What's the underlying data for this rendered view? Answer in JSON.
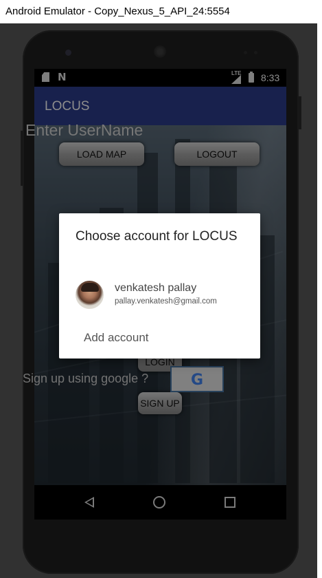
{
  "window": {
    "title": "Android Emulator - Copy_Nexus_5_API_24:5554"
  },
  "status_bar": {
    "network": "LTE",
    "time": "8:33",
    "icons": [
      "sd-card-icon",
      "n-icon",
      "signal-icon",
      "battery-icon"
    ]
  },
  "app_bar": {
    "title": "LOCUS",
    "color": "#2c3c8c"
  },
  "main": {
    "load_map_label": "LOAD MAP",
    "logout_label": "LOGOUT",
    "username_placeholder": "Enter UserName",
    "login_label": "LOGIN",
    "signup_label": "SIGN UP",
    "google_signup_text": "Sign up using google ?",
    "google_logo": "G"
  },
  "dialog": {
    "title": "Choose account for LOCUS",
    "account": {
      "name": "venkatesh pallay",
      "email": "pallay.venkatesh@gmail.com"
    },
    "add_account_label": "Add account"
  },
  "nav_bar": {
    "icons": [
      "back-icon",
      "home-icon",
      "recents-icon"
    ]
  }
}
